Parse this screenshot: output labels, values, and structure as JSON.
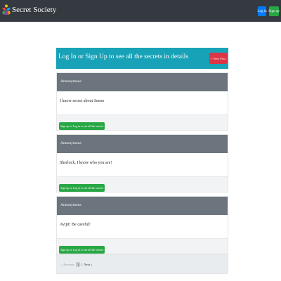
{
  "navbar": {
    "brand": "Secret Society",
    "login_label": "Log in",
    "signup_label": "Sign up"
  },
  "jumbotron": {
    "text": "Log In or Sign Up to see all the secrets in details",
    "new_post_label": "+ New Post"
  },
  "posts": [
    {
      "author": "Annonymous",
      "body": "I know secret about James",
      "button_label": "Sign up or Log in to see all the secrets"
    },
    {
      "author": "Annonymous",
      "body": "Sherlock, I know who you are!",
      "button_label": "Sign up or Log in to see all the secrets"
    },
    {
      "author": "Annonymous",
      "body": "Avijit! Be careful!",
      "button_label": "Sign up or Log in to see all the secrets"
    }
  ],
  "pagination": {
    "prev_label": "« Previous",
    "page_number": "1",
    "current_label": "1",
    "next_label": "Next »"
  },
  "colors": {
    "navbar": "#343a40",
    "jumbotron": "#17a2b8",
    "card_header": "#6c757d",
    "primary": "#007bff",
    "success": "#28a745",
    "danger": "#dc3545"
  },
  "icons": {
    "brand_logo": "colorful-figures-logo"
  }
}
